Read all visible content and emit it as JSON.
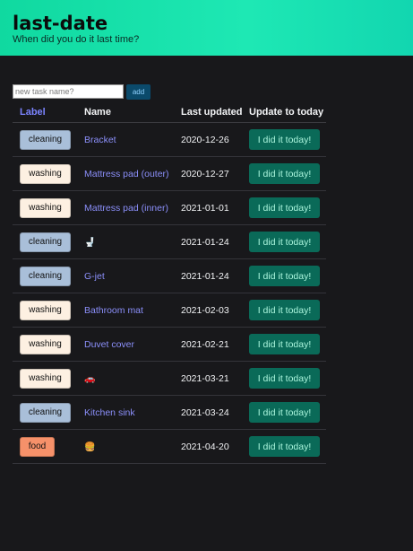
{
  "header": {
    "title": "last-date",
    "subtitle": "When did you do it last time?"
  },
  "add_form": {
    "placeholder": "new task name?",
    "button_label": "add"
  },
  "table": {
    "columns": [
      "Label",
      "Name",
      "Last updated",
      "Update to today"
    ],
    "rows": [
      {
        "label": "cleaning",
        "name": "Bracket",
        "date": "2020-12-26",
        "action": "I did it today!"
      },
      {
        "label": "washing",
        "name": "Mattress pad (outer)",
        "date": "2020-12-27",
        "action": "I did it today!"
      },
      {
        "label": "washing",
        "name": "Mattress pad (inner)",
        "date": "2021-01-01",
        "action": "I did it today!"
      },
      {
        "label": "cleaning",
        "name": "🚽",
        "date": "2021-01-24",
        "action": "I did it today!"
      },
      {
        "label": "cleaning",
        "name": "G-jet",
        "date": "2021-01-24",
        "action": "I did it today!"
      },
      {
        "label": "washing",
        "name": "Bathroom mat",
        "date": "2021-02-03",
        "action": "I did it today!"
      },
      {
        "label": "washing",
        "name": "Duvet cover",
        "date": "2021-02-21",
        "action": "I did it today!"
      },
      {
        "label": "washing",
        "name": "🚗",
        "date": "2021-03-21",
        "action": "I did it today!"
      },
      {
        "label": "cleaning",
        "name": "Kitchen sink",
        "date": "2021-03-24",
        "action": "I did it today!"
      },
      {
        "label": "food",
        "name": "🍔",
        "date": "2021-04-20",
        "action": "I did it today!"
      }
    ]
  },
  "colors": {
    "header_gradient_start": "#10d9a0",
    "header_gradient_end": "#12d6b0",
    "background": "#18181b",
    "label_cleaning": "#a9bfd9",
    "label_washing": "#fdf0e2",
    "label_food": "#f6916a",
    "link": "#8b8ffa",
    "action_button": "#0a6a58"
  }
}
